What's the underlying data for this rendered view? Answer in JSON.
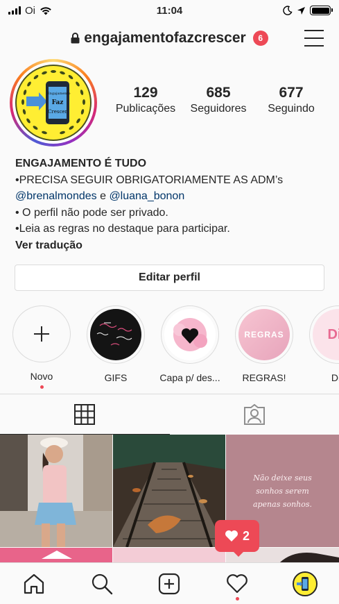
{
  "status_bar": {
    "carrier": "Oi",
    "time": "11:04"
  },
  "header": {
    "username": "engajamentofazcrescer",
    "notification_count": "6"
  },
  "profile": {
    "avatar_text": [
      "Engajamento",
      "Faz",
      "Crescer"
    ],
    "stats": [
      {
        "value": "129",
        "label": "Publicações"
      },
      {
        "value": "685",
        "label": "Seguidores"
      },
      {
        "value": "677",
        "label": "Seguindo"
      }
    ],
    "bio": {
      "name": "ENGAJAMENTO É TUDO",
      "line1": "•PRECISA SEGUIR OBRIGATORIAMENTE AS ADM’s",
      "mention1": "@brenalmondes",
      "conjunction": " e ",
      "mention2": "@luana_bonon",
      "line3": "• O perfil não pode ser privado.",
      "line4": "•Leia as regras no destaque para participar.",
      "translate": "Ver tradução"
    },
    "edit_button": "Editar perfil"
  },
  "highlights": [
    {
      "label": "Novo"
    },
    {
      "label": "GIFS"
    },
    {
      "label": "Capa p/ des..."
    },
    {
      "label": "REGRAS!",
      "thumb_text": "REGRAS"
    },
    {
      "label": "Dic",
      "thumb_text": "Dic"
    }
  ],
  "posts": [
    {
      "text": ""
    },
    {
      "text": ""
    },
    {
      "text": "Não deixe seus sonhos serem apenas sonhos."
    }
  ],
  "like_notification": {
    "count": "2"
  },
  "colors": {
    "accent": "#ed4956",
    "link": "#003569",
    "border": "#dbdbdb"
  }
}
